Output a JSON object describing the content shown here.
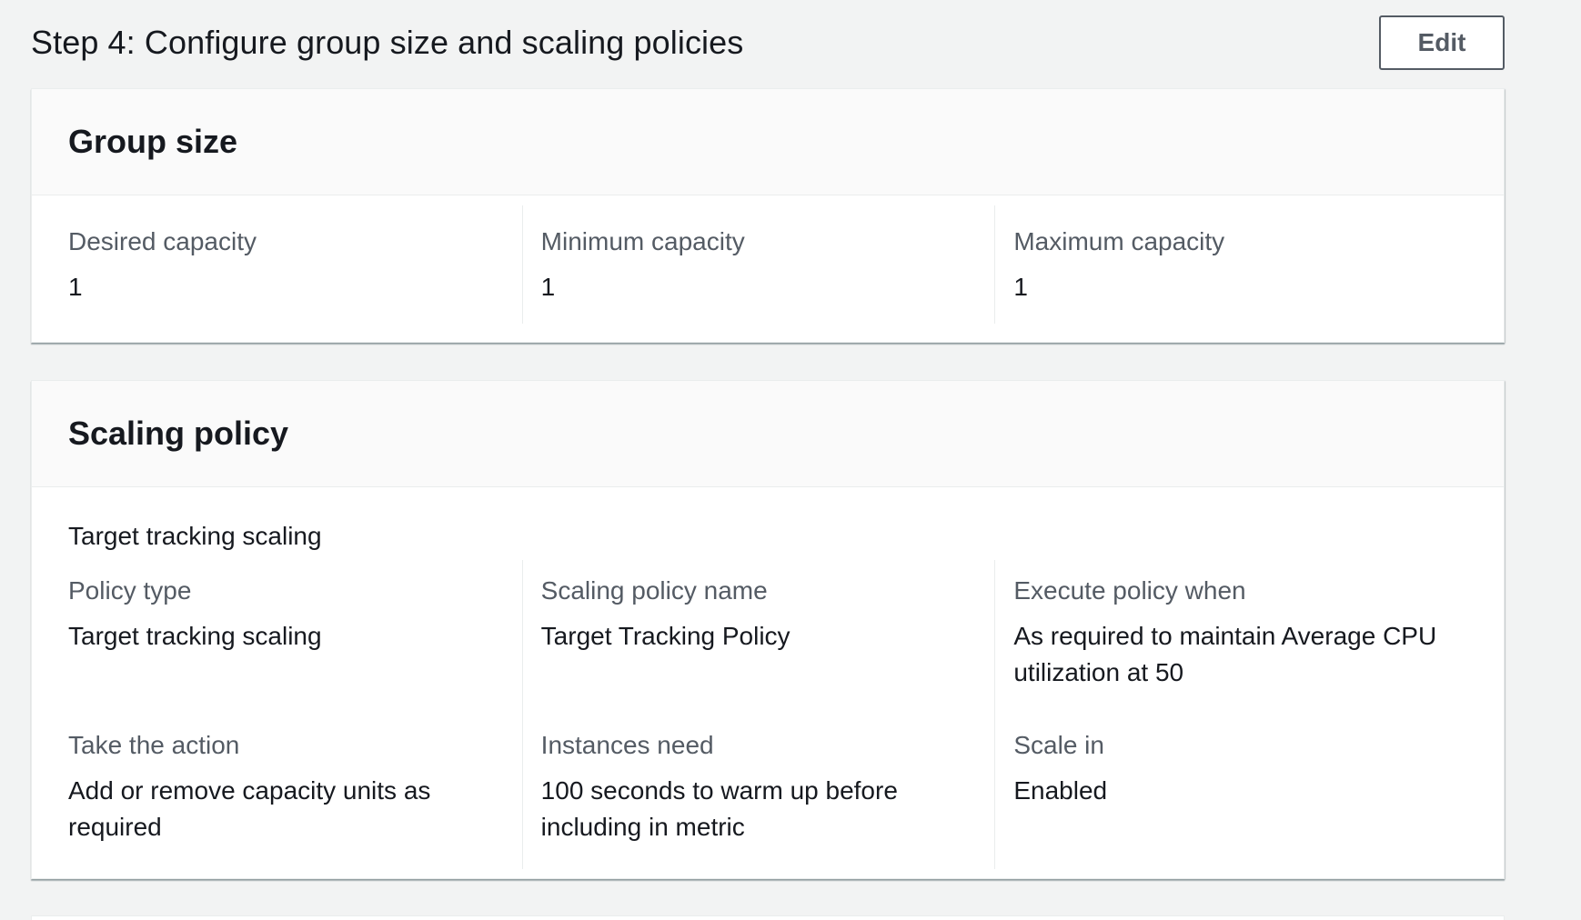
{
  "step": {
    "title": "Step 4: Configure group size and scaling policies",
    "edit_label": "Edit"
  },
  "group_size": {
    "title": "Group size",
    "fields": [
      {
        "label": "Desired capacity",
        "value": "1"
      },
      {
        "label": "Minimum capacity",
        "value": "1"
      },
      {
        "label": "Maximum capacity",
        "value": "1"
      }
    ]
  },
  "scaling_policy": {
    "title": "Scaling policy",
    "subheading": "Target tracking scaling",
    "fields": [
      {
        "label": "Policy type",
        "value": "Target tracking scaling"
      },
      {
        "label": "Scaling policy name",
        "value": "Target Tracking Policy"
      },
      {
        "label": "Execute policy when",
        "value": "As required to maintain Average CPU utilization at 50"
      },
      {
        "label": "Take the action",
        "value": "Add or remove capacity units as required"
      },
      {
        "label": "Instances need",
        "value": "100 seconds to warm up before including in metric"
      },
      {
        "label": "Scale in",
        "value": "Enabled"
      }
    ]
  }
}
